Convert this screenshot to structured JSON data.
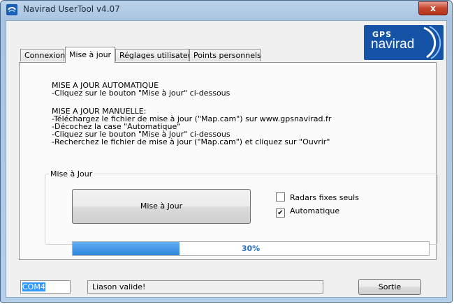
{
  "window": {
    "title": "Navirad UserTool v4.07",
    "close_label": "x"
  },
  "logo": {
    "gps": "GPS",
    "brand": "navirad"
  },
  "tabs": [
    {
      "label": "Connexion"
    },
    {
      "label": "Mise à jour"
    },
    {
      "label": "Réglages utilisateur"
    },
    {
      "label": "Points personnels"
    }
  ],
  "instructions": [
    "MISE A JOUR AUTOMATIQUE",
    "-Cliquez sur le bouton \"Mise à jour\" ci-dessous",
    "MISE A JOUR MANUELLE:",
    "-Téléchargez le fichier de mise à jour (\"Map.cam\") sur www.gpsnavirad.fr",
    "-Décochez la case \"Automatique\"",
    "-Cliquez sur le bouton \"Mise à Jour\" ci-dessous",
    "-Recherchez le fichier de mise à jour (\"Map.cam\") et cliquez sur \"Ouvrir\""
  ],
  "update_group": {
    "legend": "Mise à Jour",
    "button_label": "Mise à Jour",
    "checkbox_radars": {
      "label": "Radars fixes seuls",
      "checked": false
    },
    "checkbox_auto": {
      "label": "Automatique",
      "checked": true
    },
    "progress": {
      "fraction": 0.3,
      "text": "30%"
    }
  },
  "status": {
    "port": "COM4",
    "message": "Liason valide!",
    "exit_label": "Sortie"
  }
}
